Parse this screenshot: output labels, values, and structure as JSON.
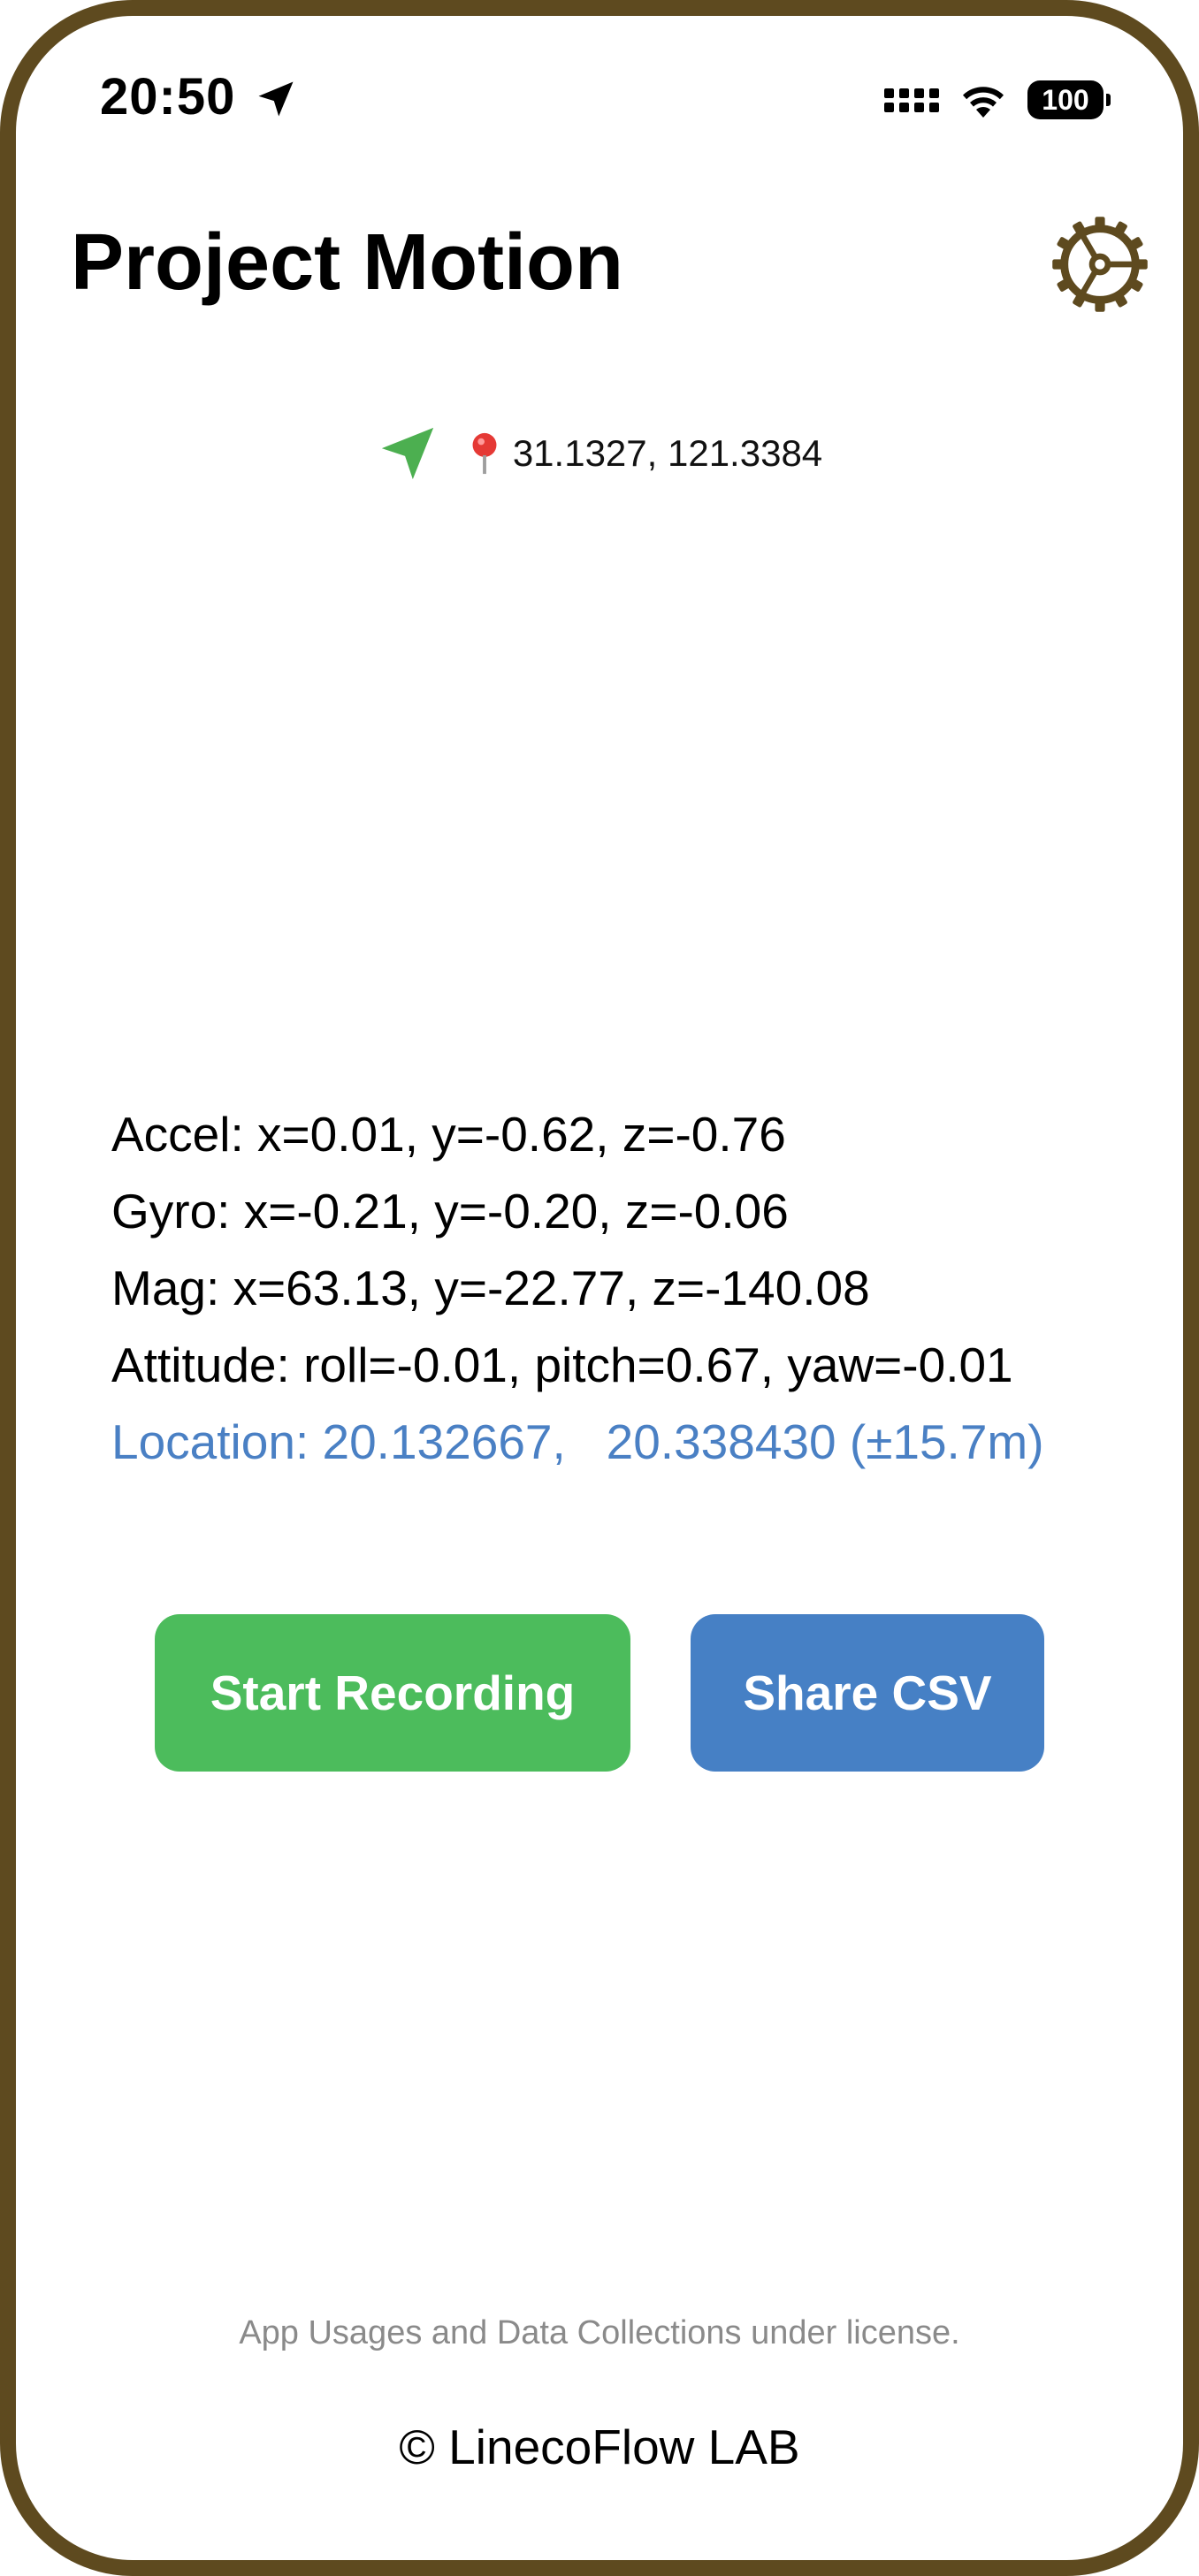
{
  "status_bar": {
    "time": "20:50",
    "battery": "100",
    "icons": [
      "location-arrow-icon",
      "cellular-signal-icon",
      "wifi-icon",
      "battery-icon"
    ]
  },
  "header": {
    "title": "Project Motion",
    "settings_icon": "gear-icon"
  },
  "location_summary": {
    "coords": "31.1327, 121.3384",
    "icons": [
      "navigation-arrow-icon",
      "map-pin-icon"
    ]
  },
  "readings": {
    "accel": "Accel: x=0.01, y=-0.62, z=-0.76",
    "gyro": "Gyro: x=-0.21, y=-0.20, z=-0.06",
    "mag": "Mag: x=63.13, y=-22.77, z=-140.08",
    "attitude": "Attitude: roll=-0.01, pitch=0.67, yaw=-0.01",
    "location": "Location: 20.132667,   20.338430 (±15.7m)"
  },
  "actions": {
    "start_label": "Start Recording",
    "share_label": "Share CSV"
  },
  "footer": {
    "note": "App Usages and Data Collections under license.",
    "copyright": "© LinecoFlow LAB"
  },
  "colors": {
    "frame": "#5e4a1f",
    "start_button": "#4cbc5c",
    "share_button": "#4680c5",
    "location_text": "#4a80c4",
    "nav_arrow": "#4caf50"
  }
}
